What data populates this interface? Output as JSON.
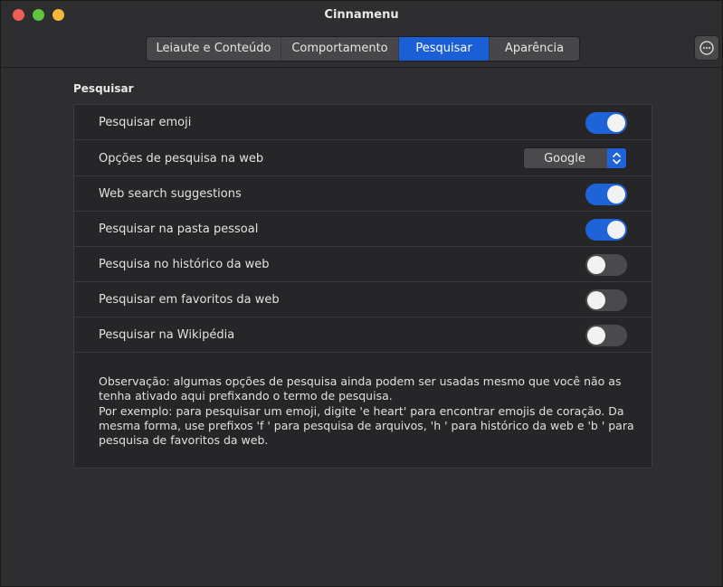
{
  "window": {
    "title": "Cinnamenu"
  },
  "tabs": [
    {
      "label": "Leiaute e Conteúdo",
      "active": false
    },
    {
      "label": "Comportamento",
      "active": false
    },
    {
      "label": "Pesquisar",
      "active": true
    },
    {
      "label": "Aparência",
      "active": false
    }
  ],
  "header": {
    "menu_icon": "more-horizontal-icon"
  },
  "section": {
    "title": "Pesquisar"
  },
  "settings": [
    {
      "label": "Pesquisar emoji",
      "type": "toggle",
      "value": true
    },
    {
      "label": "Opções de pesquisa na web",
      "type": "select",
      "value": "Google"
    },
    {
      "label": "Web search suggestions",
      "type": "toggle",
      "value": true
    },
    {
      "label": "Pesquisar na pasta pessoal",
      "type": "toggle",
      "value": true
    },
    {
      "label": "Pesquisa no histórico da web",
      "type": "toggle",
      "value": false
    },
    {
      "label": "Pesquisar em favoritos da web",
      "type": "toggle",
      "value": false
    },
    {
      "label": "Pesquisar na Wikipédia",
      "type": "toggle",
      "value": false
    }
  ],
  "note": {
    "line1": "Observação: algumas opções de pesquisa ainda podem ser usadas mesmo que você não as tenha ativado aqui prefixando o termo de pesquisa.",
    "line2": "Por exemplo: para pesquisar um emoji, digite 'e heart' para encontrar emojis de coração. Da mesma forma, use prefixos 'f ' para pesquisa de arquivos, 'h ' para histórico da web e 'b ' para pesquisa de favoritos da web."
  },
  "colors": {
    "accent": "#1f63d8",
    "close": "#ed5f55",
    "minimize": "#f5b83a",
    "maximize": "#5fc43f"
  }
}
